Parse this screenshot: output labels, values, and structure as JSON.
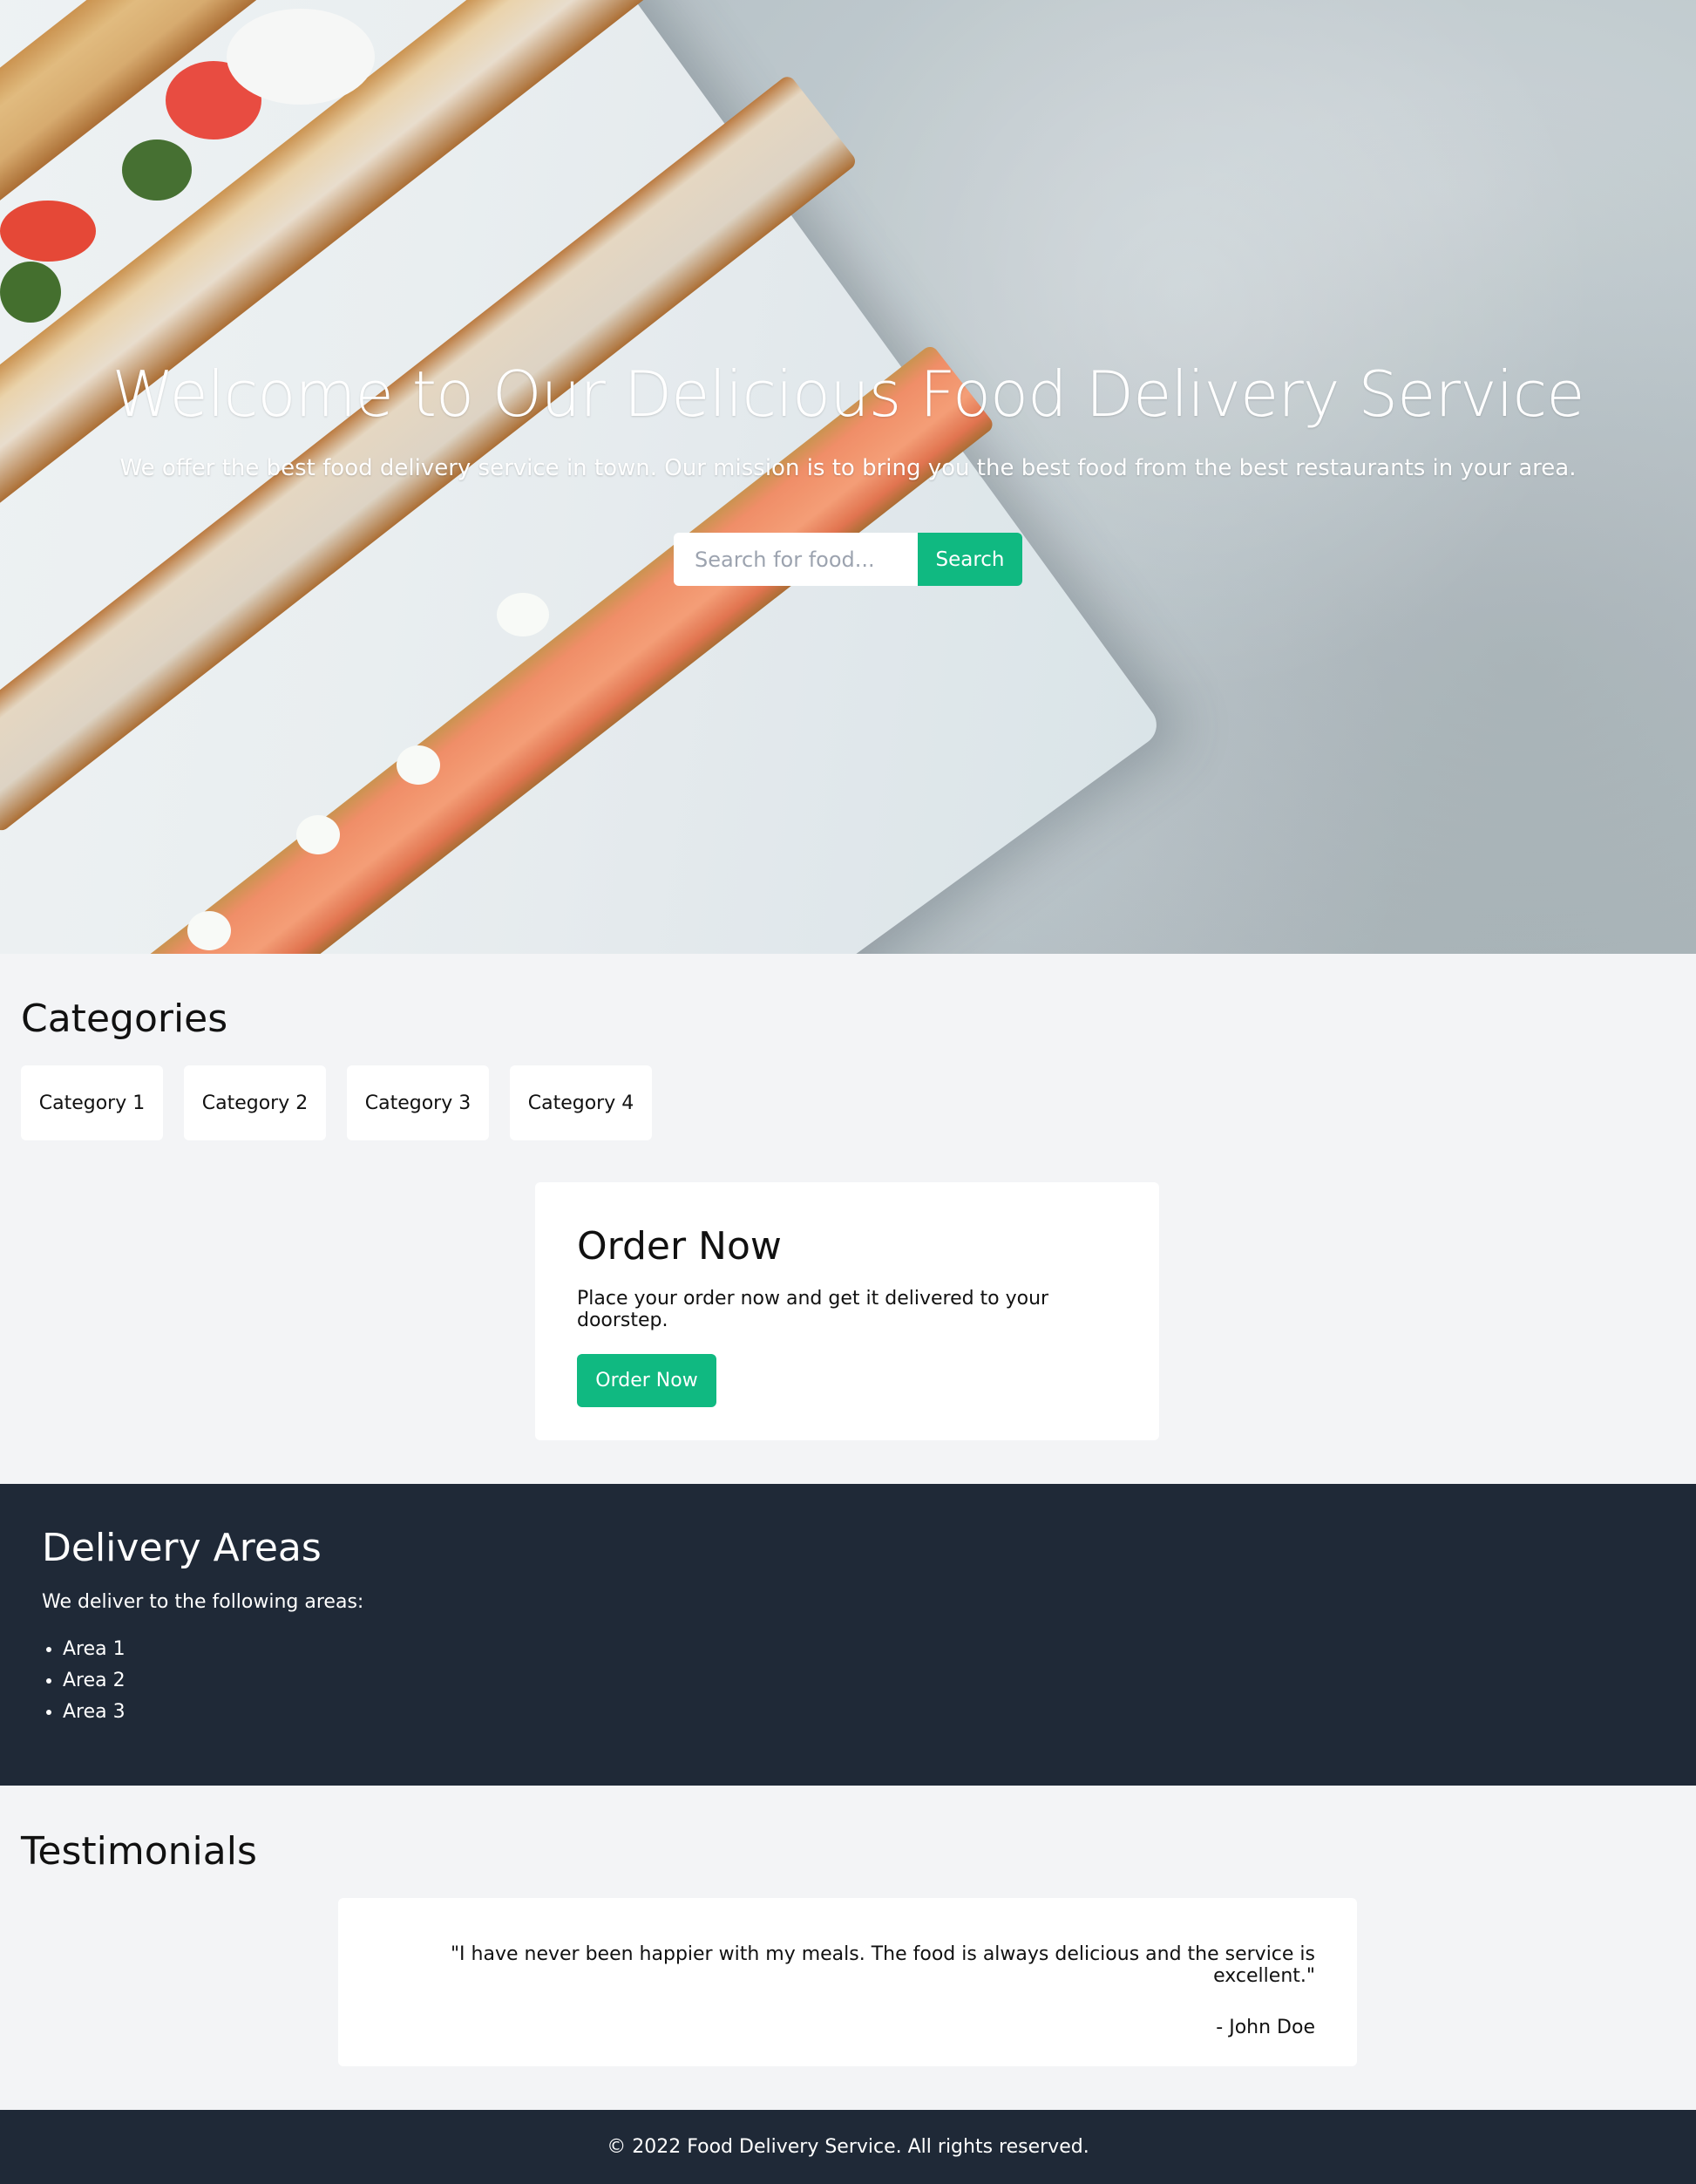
{
  "hero": {
    "title": "Welcome to Our Delicious Food Delivery Service",
    "subtitle": "We offer the best food delivery service in town. Our mission is to bring you the best food from the best restaurants in your area.",
    "search": {
      "placeholder": "Search for food...",
      "value": "",
      "button_label": "Search"
    },
    "background_image": "food-platter-on-concrete"
  },
  "categories": {
    "title": "Categories",
    "items": [
      {
        "label": "Category 1"
      },
      {
        "label": "Category 2"
      },
      {
        "label": "Category 3"
      },
      {
        "label": "Category 4"
      }
    ]
  },
  "order": {
    "title": "Order Now",
    "text": "Place your order now and get it delivered to your doorstep.",
    "button_label": "Order Now"
  },
  "delivery": {
    "title": "Delivery Areas",
    "text": "We deliver to the following areas:",
    "areas": [
      "Area 1",
      "Area 2",
      "Area 3"
    ]
  },
  "testimonials": {
    "title": "Testimonials",
    "items": [
      {
        "quote": "\"I have never been happier with my meals. The food is always delicious and the service is excellent.\"",
        "author": "- John Doe"
      }
    ]
  },
  "footer": {
    "text": "© 2022 Food Delivery Service. All rights reserved."
  },
  "colors": {
    "accent": "#10b981",
    "dark": "#1f2937",
    "page_bg": "#f3f4f6",
    "card_bg": "#ffffff"
  }
}
